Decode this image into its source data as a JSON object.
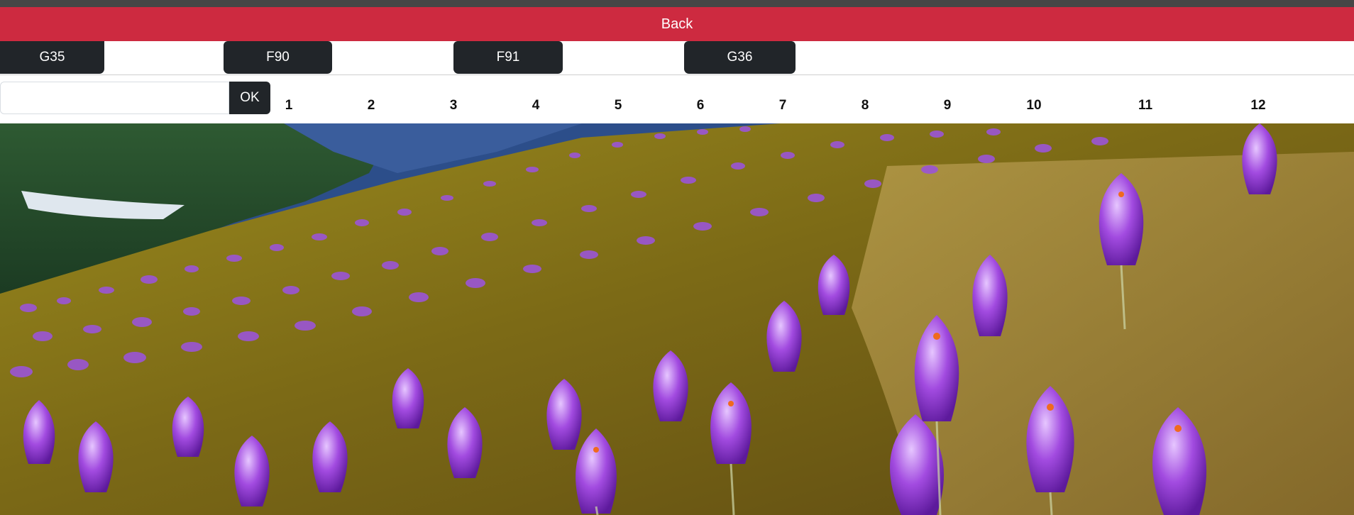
{
  "header": {
    "back_label": "Back"
  },
  "codes": [
    "G35",
    "F90",
    "F91",
    "G36"
  ],
  "search": {
    "value": "",
    "submit_label": "OK"
  },
  "pagination": [
    "1",
    "2",
    "3",
    "4",
    "5",
    "6",
    "7",
    "8",
    "9",
    "10",
    "11",
    "12"
  ],
  "colors": {
    "back_bar": "#cd2a40",
    "dark_button": "#212529",
    "top_strip": "#464646"
  },
  "image": {
    "subject": "purple crocus meadow on a mountain slope with pine forest"
  }
}
